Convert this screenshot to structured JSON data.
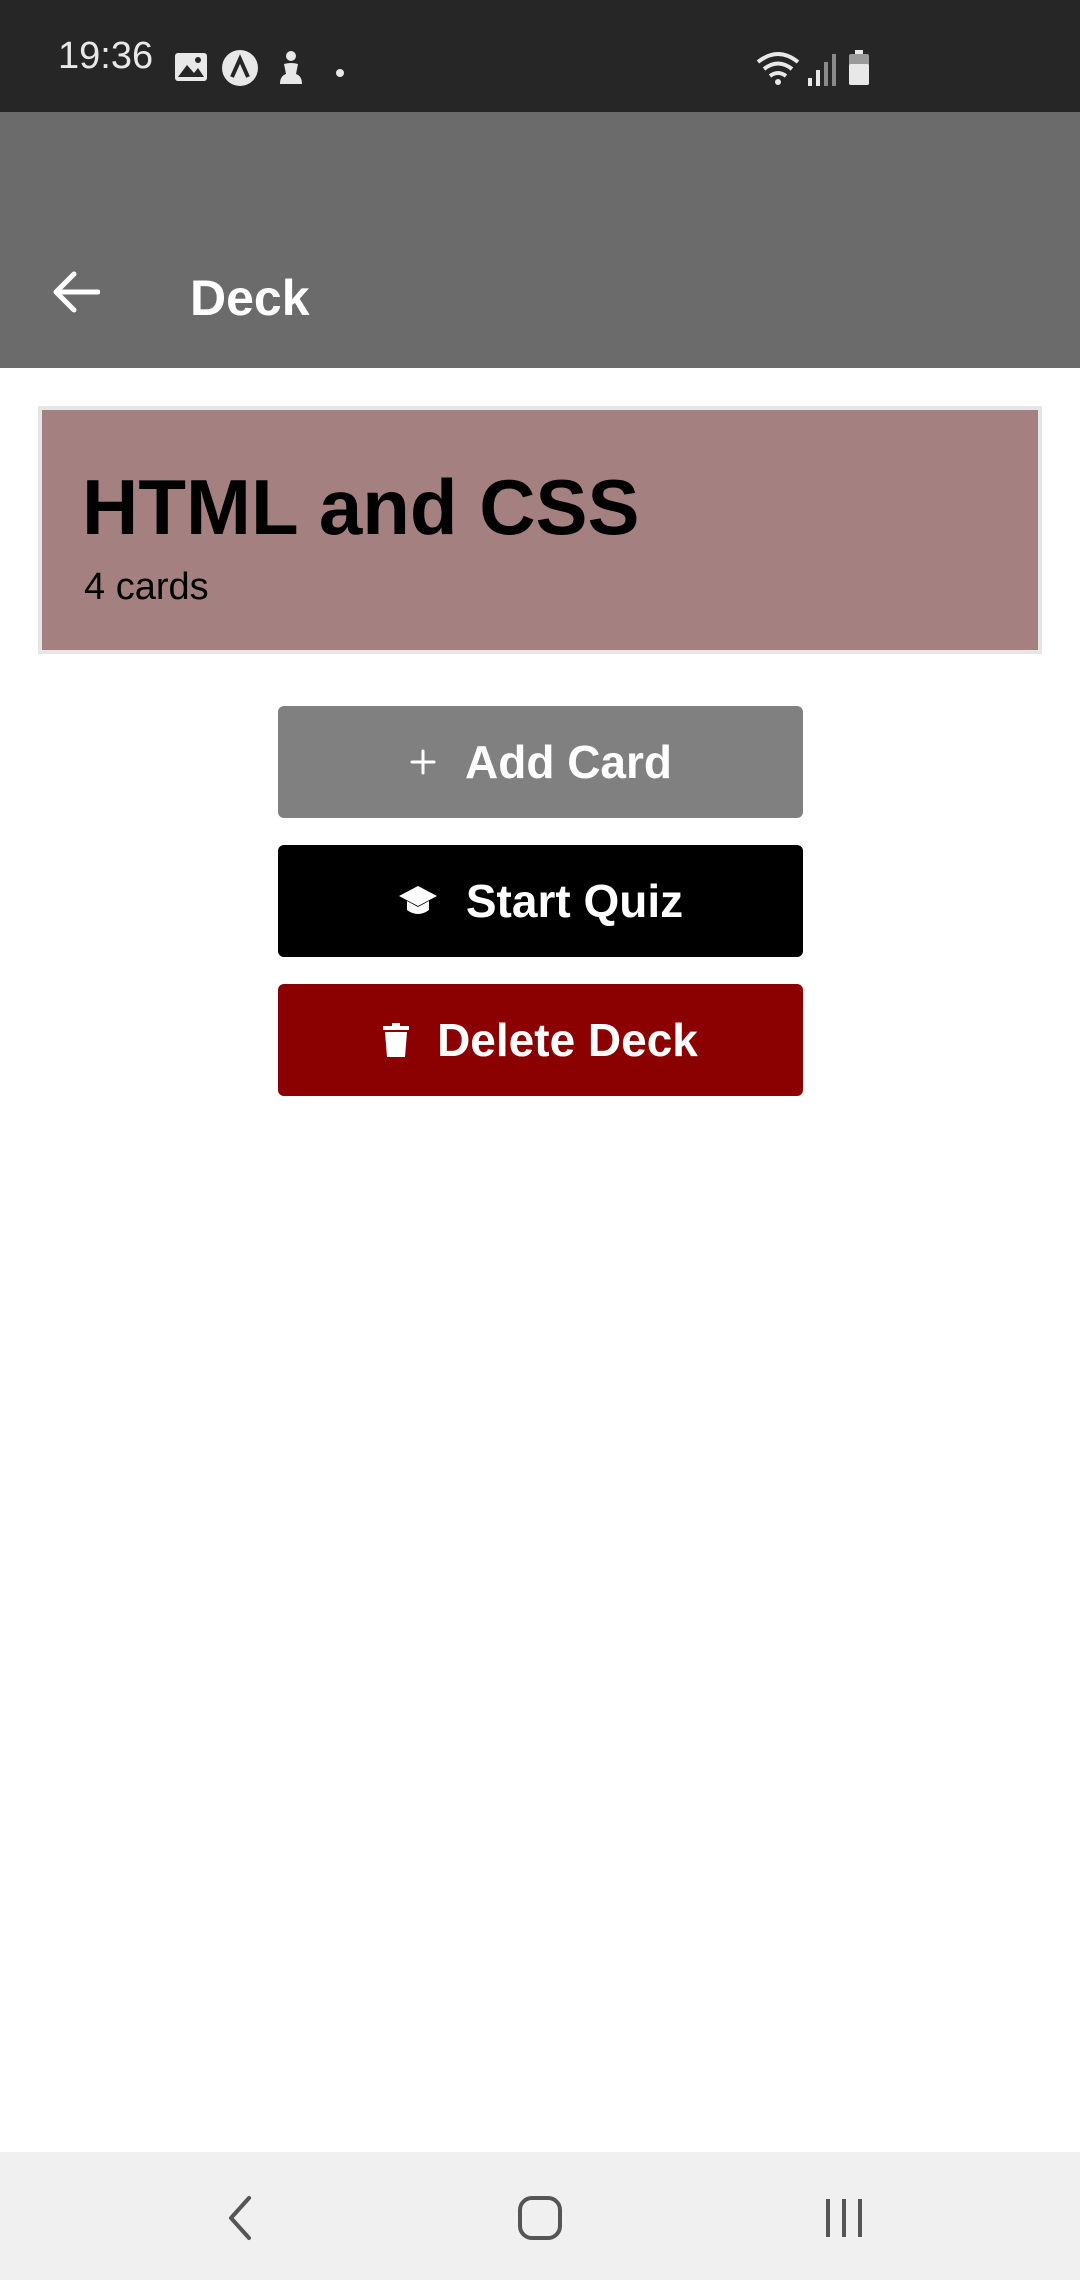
{
  "status_bar": {
    "time": "19:36",
    "left_icons": [
      "image-icon",
      "a-icon",
      "accessibility-icon",
      "dot-icon"
    ],
    "right_icons": [
      "wifi-icon",
      "signal-icon",
      "battery-icon"
    ]
  },
  "app_bar": {
    "title": "Deck",
    "back_icon": "arrow-left-icon"
  },
  "deck": {
    "title": "HTML and CSS",
    "count": "4 cards",
    "background_color": "#a48080"
  },
  "actions": {
    "add_label": "Add Card",
    "add_icon": "plus-icon",
    "quiz_label": "Start Quiz",
    "quiz_icon": "graduation-cap-icon",
    "delete_label": "Delete Deck",
    "delete_icon": "trash-icon",
    "colors": {
      "add": "#808080",
      "quiz": "#000000",
      "delete": "#8b0000"
    }
  },
  "nav_bar": {
    "icons": [
      "back-chevron-icon",
      "home-icon",
      "recents-icon"
    ]
  }
}
